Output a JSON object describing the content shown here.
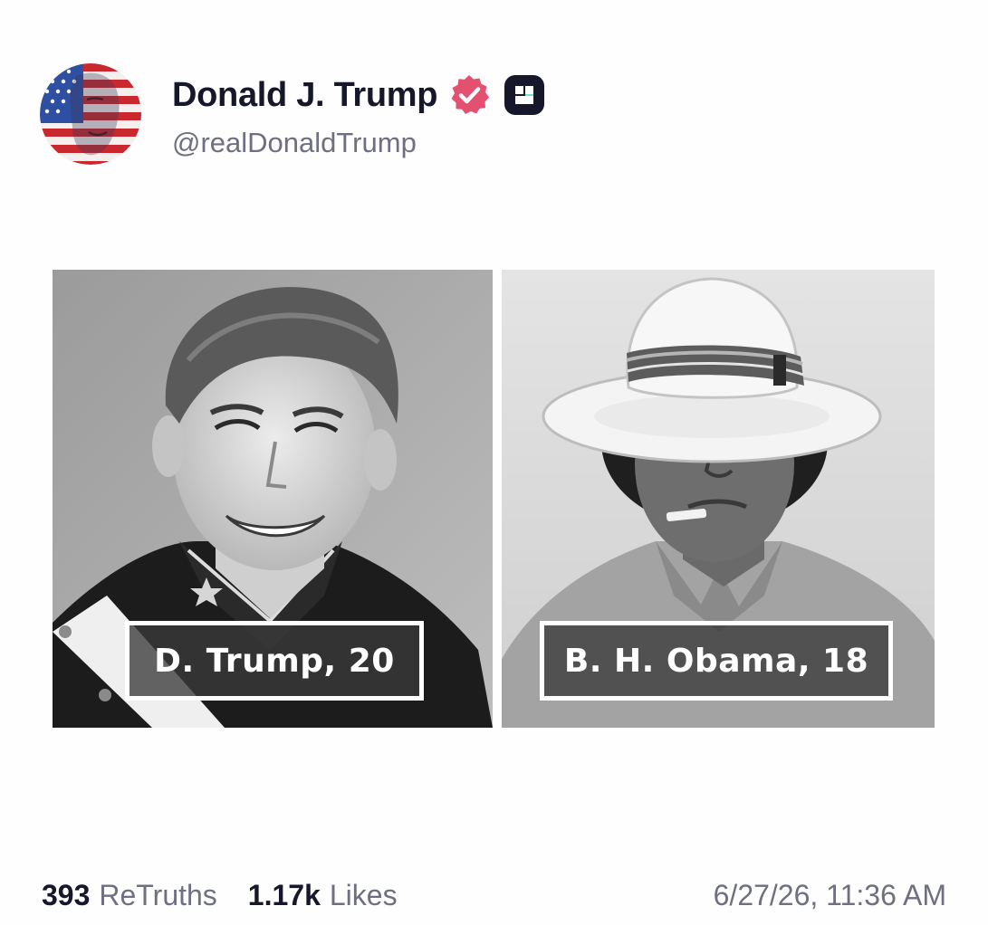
{
  "author": {
    "display_name": "Donald J. Trump",
    "handle": "@realDonaldTrump",
    "avatar_icon": "flag-portrait-avatar",
    "verified_icon": "verified-check-badge-icon",
    "plus_icon": "truth-plus-badge-icon"
  },
  "media": {
    "left_photo": {
      "caption": "D. Trump, 20",
      "icon": "black-and-white-portrait-photo"
    },
    "right_photo": {
      "caption": "B. H. Obama, 18",
      "icon": "black-and-white-portrait-photo"
    }
  },
  "stats": {
    "retruths_count": "393",
    "retruths_label": "ReTruths",
    "likes_count": "1.17k",
    "likes_label": "Likes"
  },
  "timestamp": "6/27/26, 11:36 AM",
  "colors": {
    "text_primary": "#16172a",
    "text_secondary": "#6e6f82",
    "verified_pink": "#e4506f",
    "plus_badge": "#16172a"
  }
}
